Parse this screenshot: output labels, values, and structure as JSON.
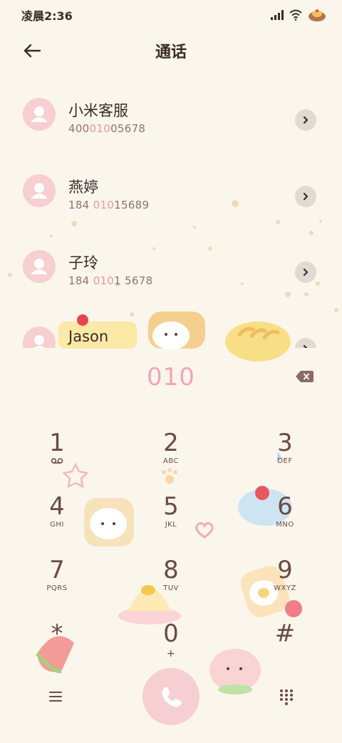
{
  "status_bar": {
    "time": "凌晨2:36",
    "icons": [
      "signal-icon",
      "wifi-icon",
      "bread-avatar-icon"
    ]
  },
  "header": {
    "title": "通话",
    "back_icon": "back-arrow-icon"
  },
  "contacts": [
    {
      "name": "小米客服",
      "number_prefix": "400",
      "number_match": "010",
      "number_suffix": "05678"
    },
    {
      "name": "燕婷",
      "number_prefix": "184 ",
      "number_match": "010",
      "number_suffix": "15689"
    },
    {
      "name": "子玲",
      "number_prefix": "184 ",
      "number_match": "010",
      "number_suffix": "1 5678"
    },
    {
      "name": "Jason",
      "number_prefix": "",
      "number_match": "",
      "number_suffix": ""
    }
  ],
  "dialer": {
    "input_value": "010",
    "backspace_icon": "backspace-icon"
  },
  "keypad": [
    {
      "digit": "1",
      "letters": "",
      "sub_icon": "voicemail-icon"
    },
    {
      "digit": "2",
      "letters": "ABC"
    },
    {
      "digit": "3",
      "letters": "DEF"
    },
    {
      "digit": "4",
      "letters": "GHI"
    },
    {
      "digit": "5",
      "letters": "JKL"
    },
    {
      "digit": "6",
      "letters": "MNO"
    },
    {
      "digit": "7",
      "letters": "PQRS"
    },
    {
      "digit": "8",
      "letters": "TUV"
    },
    {
      "digit": "9",
      "letters": "WXYZ"
    },
    {
      "digit": "*",
      "letters": ""
    },
    {
      "digit": "0",
      "letters": "+"
    },
    {
      "digit": "#",
      "letters": ""
    }
  ],
  "bottom_bar": {
    "menu_icon": "menu-icon",
    "call_icon": "phone-icon",
    "keypad_icon": "dialpad-icon"
  },
  "colors": {
    "background": "#fbf6ec",
    "accent_pink": "#f3a4b8",
    "avatar_pink": "#f7cfd0",
    "text_brown": "#6a4a42"
  }
}
